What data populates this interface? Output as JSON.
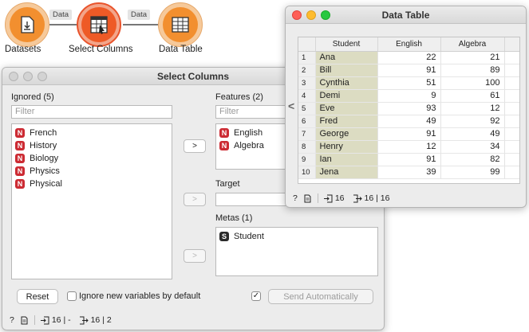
{
  "workflow": {
    "nodes": [
      {
        "label": "Datasets",
        "icon": "file-upload-icon"
      },
      {
        "label": "Select Columns",
        "icon": "select-columns-icon"
      },
      {
        "label": "Data Table",
        "icon": "table-icon"
      }
    ],
    "links": [
      {
        "label": "Data"
      },
      {
        "label": "Data"
      }
    ]
  },
  "select_columns": {
    "title": "Select Columns",
    "ignored": {
      "label": "Ignored (5)",
      "filter_placeholder": "Filter",
      "items": [
        {
          "type": "N",
          "name": "French"
        },
        {
          "type": "N",
          "name": "History"
        },
        {
          "type": "N",
          "name": "Biology"
        },
        {
          "type": "N",
          "name": "Physics"
        },
        {
          "type": "N",
          "name": "Physical"
        }
      ]
    },
    "features": {
      "label": "Features (2)",
      "filter_placeholder": "Filter",
      "items": [
        {
          "type": "N",
          "name": "English"
        },
        {
          "type": "N",
          "name": "Algebra"
        }
      ]
    },
    "target": {
      "label": "Target"
    },
    "metas": {
      "label": "Metas (1)",
      "items": [
        {
          "type": "S",
          "name": "Student"
        }
      ]
    },
    "move_buttons": [
      ">",
      ">",
      ">"
    ],
    "reset_label": "Reset",
    "ignore_new_label": "Ignore new variables by default",
    "ignore_new_checked": false,
    "send_auto_checked": true,
    "send_auto_label": "Send Automatically",
    "status": {
      "input": "16 | -",
      "output": "16 | 2"
    }
  },
  "data_table": {
    "title": "Data Table",
    "columns": [
      "Student",
      "English",
      "Algebra"
    ],
    "rows": [
      {
        "n": "1",
        "student": "Ana",
        "english": "22",
        "algebra": "21"
      },
      {
        "n": "2",
        "student": "Bill",
        "english": "91",
        "algebra": "89"
      },
      {
        "n": "3",
        "student": "Cynthia",
        "english": "51",
        "algebra": "100"
      },
      {
        "n": "4",
        "student": "Demi",
        "english": "9",
        "algebra": "61"
      },
      {
        "n": "5",
        "student": "Eve",
        "english": "93",
        "algebra": "12"
      },
      {
        "n": "6",
        "student": "Fred",
        "english": "49",
        "algebra": "92"
      },
      {
        "n": "7",
        "student": "George",
        "english": "91",
        "algebra": "49"
      },
      {
        "n": "8",
        "student": "Henry",
        "english": "12",
        "algebra": "34"
      },
      {
        "n": "9",
        "student": "Ian",
        "english": "91",
        "algebra": "82"
      },
      {
        "n": "10",
        "student": "Jena",
        "english": "39",
        "algebra": "99"
      }
    ],
    "collapse_arrow": "<",
    "status": {
      "input": "16",
      "output": "16 | 16"
    }
  },
  "colors": {
    "widget_orange": "#f28f2f",
    "widget_active": "#ee5a26",
    "numeric_badge": "#cc2b33",
    "meta_cell": "#dcdcc2"
  }
}
